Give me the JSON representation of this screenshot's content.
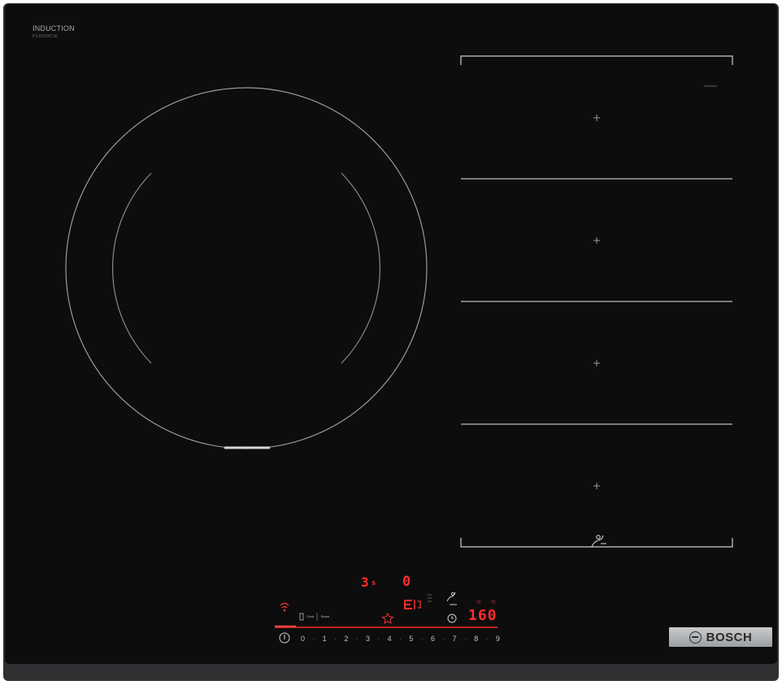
{
  "panel": {
    "induction_label": "INDUCTION",
    "model_code": "PXJ651HC1E",
    "zone_note": "induction",
    "brand": "BOSCH",
    "brand_logo_icon": "bosch-logo-icon"
  },
  "controls": {
    "timer_digit": "3",
    "timer_unit": "s",
    "top_readout": "0",
    "temperature": "160",
    "temp_unit_left": "°C",
    "temp_unit_right": "°C",
    "small_a": "Cook",
    "small_b": "Boost",
    "power_levels": [
      "0",
      "·",
      "1",
      "·",
      "2",
      "·",
      "3",
      "·",
      "4",
      "·",
      "5",
      "·",
      "6",
      "·",
      "7",
      "·",
      "8",
      "·",
      "9"
    ],
    "icons": [
      "power-icon",
      "wifi-icon",
      "favourite-icon",
      "timer-icon",
      "sensor-icon",
      "pan-detect-icon"
    ],
    "accent_red": "#ff2d2d",
    "glass_black": "#0d0d0d"
  }
}
